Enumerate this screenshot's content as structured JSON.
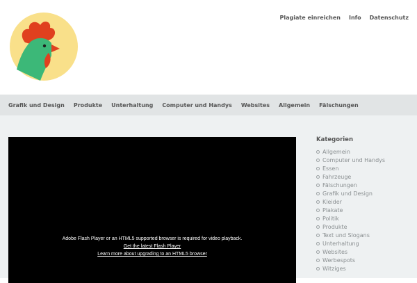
{
  "header": {
    "top_nav": [
      "Plagiate einreichen",
      "Info",
      "Datenschutz"
    ]
  },
  "category_nav": [
    "Grafik und Design",
    "Produkte",
    "Unterhaltung",
    "Computer und Handys",
    "Websites",
    "Allgemein",
    "Fälschungen"
  ],
  "video": {
    "message": "Adobe Flash Player or an HTML5 supported browser is required for video playback.",
    "link1": "Get the latest Flash Player",
    "link2": "Learn more about upgrading to an HTML5 browser"
  },
  "sidebar": {
    "title": "Kategorien",
    "items": [
      "Allgemein",
      "Computer und Handys",
      "Essen",
      "Fahrzeuge",
      "Fälschungen",
      "Grafik und Design",
      "Kleider",
      "Plakate",
      "Politik",
      "Produkte",
      "Text und Slogans",
      "Unterhaltung",
      "Websites",
      "Werbespots",
      "Witziges"
    ]
  },
  "colors": {
    "logo_bg": "#f9e08a",
    "rooster_comb": "#e0401f",
    "rooster_neck": "#3cb878",
    "nav_bar": "#e1e4e5",
    "content_bg": "#eef1f2"
  },
  "icons": {
    "logo": "rooster-logo-icon",
    "list_bullet": "circle-bullet-icon"
  }
}
